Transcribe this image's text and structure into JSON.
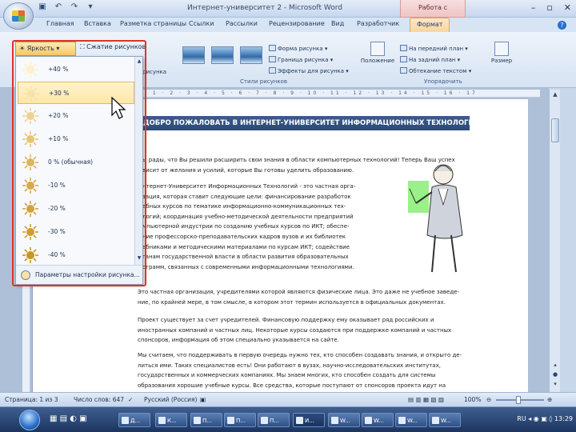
{
  "window": {
    "title": "Интернет-университет 2 - Microsoft Word",
    "context_tab_group": "Работа с рисунками"
  },
  "tabs": [
    "Главная",
    "Вставка",
    "Разметка страницы",
    "Ссылки",
    "Рассылки",
    "Рецензирование",
    "Вид",
    "Разработчик",
    "Формат"
  ],
  "ribbon": {
    "brightness_label": "Яркость",
    "compress_label": "Сжатие рисунков",
    "fragment_label": "рисунка",
    "styles_group_label": "Стили рисунков",
    "shape_label": "Форма рисунка",
    "border_label": "Граница рисунка",
    "effects_label": "Эффекты для рисунка",
    "position_label": "Положение",
    "bring_front_label": "На передний план",
    "send_back_label": "На задний план",
    "wrap_label": "Обтекание текстом",
    "arrange_group_label": "Упорядочить",
    "size_label": "Размер"
  },
  "brightness_menu": {
    "items": [
      "+40 %",
      "+30 %",
      "+20 %",
      "+10 %",
      "0 % (обычная)",
      "-10 %",
      "-20 %",
      "-30 %",
      "-40 %"
    ],
    "hover_index": 1,
    "footer_label": "Параметры настройки рисунка..."
  },
  "ruler": {
    "numbers": "· 1 · 2 · 3 · 4 · 5 · 6 · 7 · 8 · 9 · 10 · 11 · 12 · 13 · 14 · 15 · 16 · 17"
  },
  "document": {
    "banner": "ДОБРО ПОЖАЛОВАТЬ В ИНТЕРНЕТ-УНИВЕРСИТЕТ ИНФОРМАЦИОННЫХ ТЕХНОЛОГИЙ!",
    "intro_lines": [
      "ы рады, что Вы решили расширить свои знания в области компьютерных технологий! Теперь Ваш успех",
      "висит от желания и усилий, которые Вы готовы уделить образованию."
    ],
    "wrap_lines": [
      "нтернет-Университет Информационных Технологий - это частная орга-",
      "зация, которая ставит следующие цели: финансирование разработок",
      "ебных курсов по тематике информационно-коммуникационных тех-",
      "логий; координация учебно-методической деятельности предприятий",
      "мпьютерной индустрии по созданию учебных курсов по ИКТ; обеспе-",
      "ние профессорско-преподавательских кадров вузов и их библиотек",
      "ебниками и методическими материалами по курсам ИКТ; содействие",
      "ганам государственной власти в области развития образовательных",
      "ограмм, связанных с современными информационными технологиями."
    ],
    "para2_lines": [
      "Это частная организация, учредителями которой являются физические лица. Это даже не учебное заведе-",
      "ние, по крайней мере, в том смысле, в котором этот термин используется в официальных документах."
    ],
    "para3_lines": [
      "Проект существует за счет учредителей. Финансовую поддержку ему оказывает ряд российских и",
      "иностранных компаний и частных лиц. Некоторые курсы создаются при поддержке компаний и частных",
      "спонсоров, информация об этом специально указывается на сайте."
    ],
    "para4_lines": [
      "Мы считаем, что поддерживать в первую очередь нужно тех, кто способен создавать знания, и открыто де-",
      "литься ими. Таких специалистов есть! Они работают в вузах, научно-исследовательских институтах,",
      "государственных и коммерческих компаниях. Мы знаем многих, кто способен создать для системы",
      "образования хорошие учебные курсы. Все средства, которые поступают от спонсоров проекта идут на"
    ]
  },
  "statusbar": {
    "page": "Страница: 1 из 3",
    "words": "Число слов: 647",
    "language": "Русский (Россия)",
    "zoom": "100%"
  },
  "taskbar": {
    "buttons": [
      "Д...",
      "К...",
      "П...",
      "П...",
      "П...",
      "И...",
      "W...",
      "W...",
      "W...",
      "W..."
    ],
    "active_index": 5,
    "clock": "13:29",
    "tray_lang": "RU"
  },
  "colors": {
    "accent": "#2c4a76",
    "hover": "#fde7a6",
    "highlight": "#e0322a"
  }
}
